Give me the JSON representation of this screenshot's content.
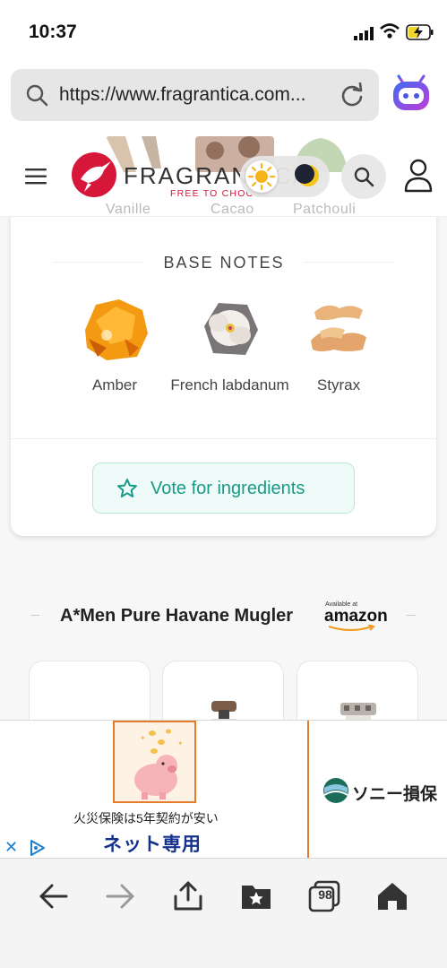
{
  "status_bar": {
    "time": "10:37"
  },
  "browser": {
    "url": "https://www.fragrantica.com...",
    "tabs_count": "98"
  },
  "header": {
    "logo_text": "FRAGRANTICA",
    "logo_tagline": "FREE TO CHOOSE",
    "peek_labels": [
      "Vanille",
      "Cacao",
      "Patchouli"
    ]
  },
  "base_notes": {
    "heading": "BASE NOTES",
    "items": [
      {
        "label": "Amber"
      },
      {
        "label": "French labdanum"
      },
      {
        "label": "Styrax"
      }
    ],
    "vote_button": "Vote for ingredients"
  },
  "amazon": {
    "title": "A*Men Pure Havane Mugler",
    "available_at": "Available at",
    "brand": "amazon"
  },
  "ad": {
    "line1": "火災保険は5年契約が安い",
    "line2": "ネット専用",
    "brand": "ソニー損保"
  },
  "colors": {
    "brand_red": "#d7173a",
    "accent_teal": "#1b9a86",
    "ad_orange": "#e57b2c"
  }
}
